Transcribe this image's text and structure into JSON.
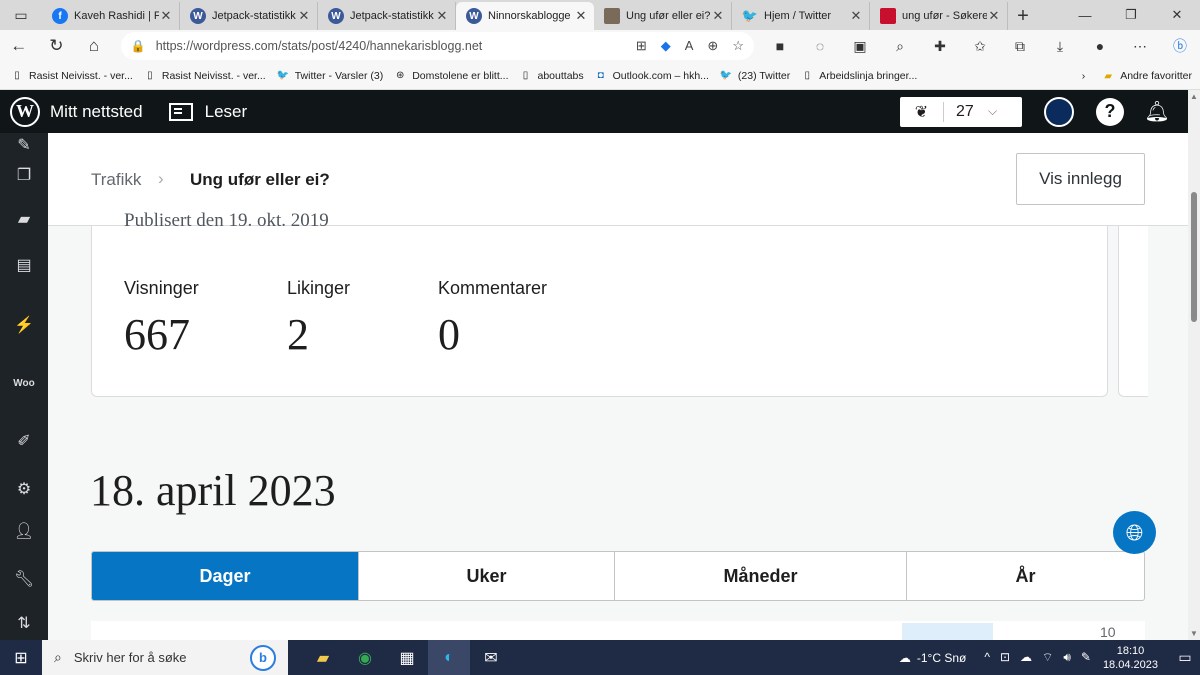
{
  "browser": {
    "tabs": [
      {
        "label": "Kaveh Rashidi | Fa",
        "icon": "facebook-icon",
        "color": "#1877f2"
      },
      {
        "label": "Jetpack-statistikk",
        "icon": "wordpress-icon",
        "color": "#3c5a9a"
      },
      {
        "label": "Jetpack-statistikk",
        "icon": "wordpress-icon",
        "color": "#3c5a9a"
      },
      {
        "label": "Ninnorskablogge",
        "icon": "wordpress-icon",
        "color": "#3c5a9a",
        "active": true
      },
      {
        "label": "Ung ufør eller ei?",
        "icon": "photo-icon",
        "color": "#7a6a5a"
      },
      {
        "label": "Hjem / Twitter",
        "icon": "twitter-icon",
        "color": "#1d9bf0"
      },
      {
        "label": "ung ufør - Søkere",
        "icon": "search-result-icon",
        "color": "#c8102e"
      }
    ],
    "new_tab": "+",
    "url": "https://wordpress.com/stats/post/4240/hannekarisblogg.net",
    "favorites": [
      {
        "label": "Rasist Neivisst. - ver...",
        "icon": "page-icon"
      },
      {
        "label": "Rasist Neivisst. - ver...",
        "icon": "page-icon"
      },
      {
        "label": "Twitter - Varsler (3)",
        "icon": "twitter-icon"
      },
      {
        "label": "Domstolene er blitt...",
        "icon": "page-icon"
      },
      {
        "label": "abouttabs",
        "icon": "page-icon"
      },
      {
        "label": "Outlook.com – hkh...",
        "icon": "outlook-icon"
      },
      {
        "label": "(23) Twitter",
        "icon": "twitter-icon"
      },
      {
        "label": "Arbeidslinja bringer...",
        "icon": "page-icon"
      }
    ],
    "other_favorites": "Andre favoritter"
  },
  "wp_bar": {
    "site": "Mitt nettsted",
    "reader": "Leser",
    "count": "27"
  },
  "header": {
    "crumb_parent": "Trafikk",
    "crumb_current": "Ung ufør eller ei?",
    "view_post": "Vis innlegg"
  },
  "post": {
    "published": "Publisert den 19. okt. 2019",
    "stats": [
      {
        "label": "Visninger",
        "value": "667"
      },
      {
        "label": "Likinger",
        "value": "2"
      },
      {
        "label": "Kommentarer",
        "value": "0"
      }
    ]
  },
  "date_heading": "18. april 2023",
  "periods": [
    "Dager",
    "Uker",
    "Måneder",
    "År"
  ],
  "chart_peek": {
    "y_tick": "10"
  },
  "taskbar": {
    "search_placeholder": "Skriv her for å søke",
    "weather": "-1°C Snø",
    "time": "18:10",
    "date": "18.04.2023"
  },
  "colors": {
    "accent": "#0675c4",
    "wp_bar": "#101517",
    "sidebar": "#1d2327"
  }
}
